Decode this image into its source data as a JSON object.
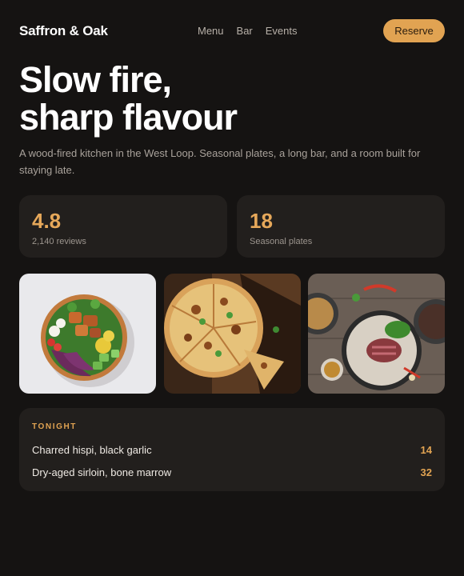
{
  "brand": "Saffron & Oak",
  "nav": {
    "links": [
      "Menu",
      "Bar",
      "Events"
    ],
    "cta": "Reserve"
  },
  "hero": {
    "line1": "Slow fire,",
    "line2": "sharp flavour",
    "intro": "A wood-fired kitchen in the West Loop. Seasonal plates, a long bar, and a room built for staying late."
  },
  "stats": [
    {
      "value": "4.8",
      "label": "2,140 reviews"
    },
    {
      "value": "18",
      "label": "Seasonal plates"
    }
  ],
  "gallery": [
    {
      "icon": "salad-bowl-photo"
    },
    {
      "icon": "pizza-photo"
    },
    {
      "icon": "steak-plates-photo"
    }
  ],
  "tonight": {
    "heading": "TONIGHT",
    "items": [
      {
        "name": "Charred hispi, black garlic",
        "price": "14"
      },
      {
        "name": "Dry-aged sirloin, bone marrow",
        "price": "32"
      }
    ]
  },
  "colors": {
    "background": "#151312",
    "card": "#221f1d",
    "accent": "#e1a352"
  }
}
